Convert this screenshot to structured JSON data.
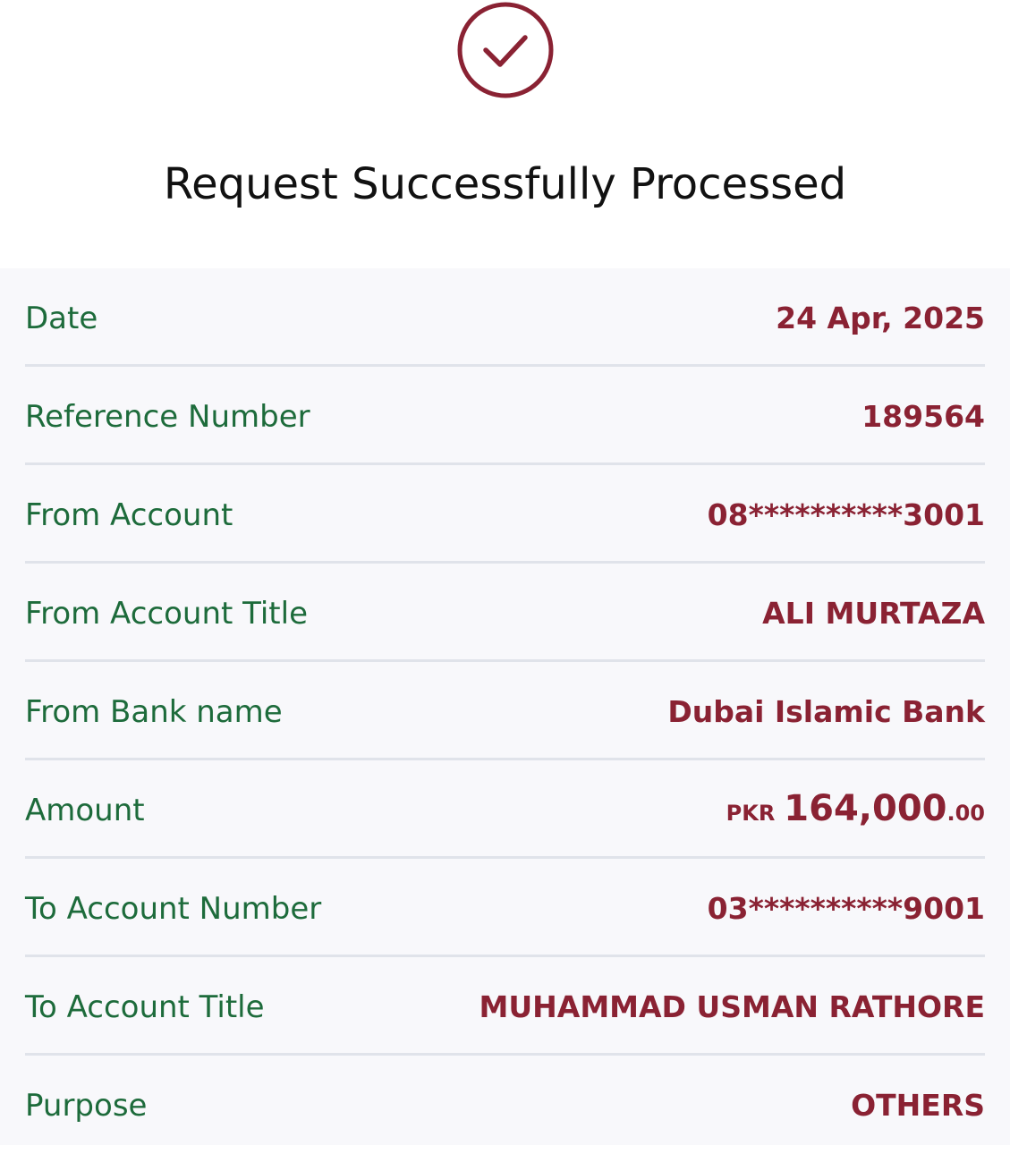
{
  "header": {
    "title": "Request Successfully Processed",
    "icon": "check-circle-icon",
    "accent_color": "#8a2233"
  },
  "details": [
    {
      "label": "Date",
      "value": "24 Apr, 2025"
    },
    {
      "label": "Reference Number",
      "value": "189564"
    },
    {
      "label": "From Account",
      "value": "08**********3001"
    },
    {
      "label": "From Account Title",
      "value": "ALI MURTAZA"
    },
    {
      "label": "From Bank name",
      "value": "Dubai Islamic Bank"
    },
    {
      "label": "Amount",
      "currency": "PKR",
      "amount_main": "164,000",
      "amount_decimal": ".00"
    },
    {
      "label": "To Account Number",
      "value": "03**********9001"
    },
    {
      "label": "To Account Title",
      "value": "MUHAMMAD USMAN RATHORE"
    },
    {
      "label": "Purpose",
      "value": "OTHERS"
    }
  ],
  "colors": {
    "label": "#1d6b3b",
    "value": "#8a2233",
    "panel_background": "#f8f8fb",
    "separator": "#e0e3ea"
  }
}
